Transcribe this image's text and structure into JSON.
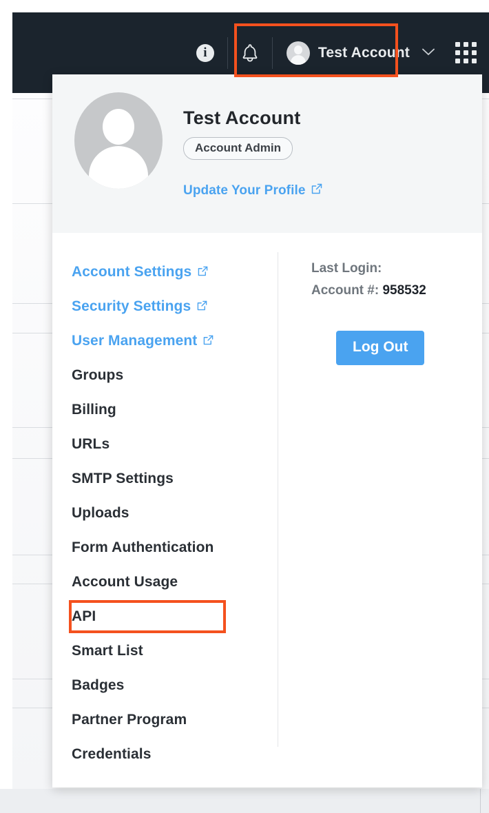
{
  "topbar": {
    "info_icon": "info-icon",
    "bell_icon": "bell-icon",
    "grid_icon": "apps-grid-icon",
    "account_name": "Test Account",
    "chevron": "∨"
  },
  "panel": {
    "avatar": "user-avatar",
    "name": "Test Account",
    "role": "Account Admin",
    "profile_link": "Update Your Profile",
    "external_icon": "external-link-icon"
  },
  "menu": {
    "items": [
      {
        "label": "Account Settings",
        "external": true
      },
      {
        "label": "Security Settings",
        "external": true
      },
      {
        "label": "User Management",
        "external": true
      },
      {
        "label": "Groups",
        "external": false
      },
      {
        "label": "Billing",
        "external": false
      },
      {
        "label": "URLs",
        "external": false
      },
      {
        "label": "SMTP Settings",
        "external": false
      },
      {
        "label": "Uploads",
        "external": false
      },
      {
        "label": "Form Authentication",
        "external": false
      },
      {
        "label": "Account Usage",
        "external": false
      },
      {
        "label": "API",
        "external": false
      },
      {
        "label": "Smart List",
        "external": false
      },
      {
        "label": "Badges",
        "external": false
      },
      {
        "label": "Partner Program",
        "external": false
      },
      {
        "label": "Credentials",
        "external": false
      }
    ]
  },
  "info": {
    "last_login_label": "Last Login:",
    "last_login_value": "",
    "account_label": "Account #:",
    "account_number": "958532",
    "logout_label": "Log Out"
  },
  "colors": {
    "topbar_bg": "#1b242d",
    "accent_blue": "#4aa3f0",
    "highlight_red": "#f4511e",
    "panel_header_bg": "#f4f6f7",
    "text_dark": "#2a2f35"
  }
}
